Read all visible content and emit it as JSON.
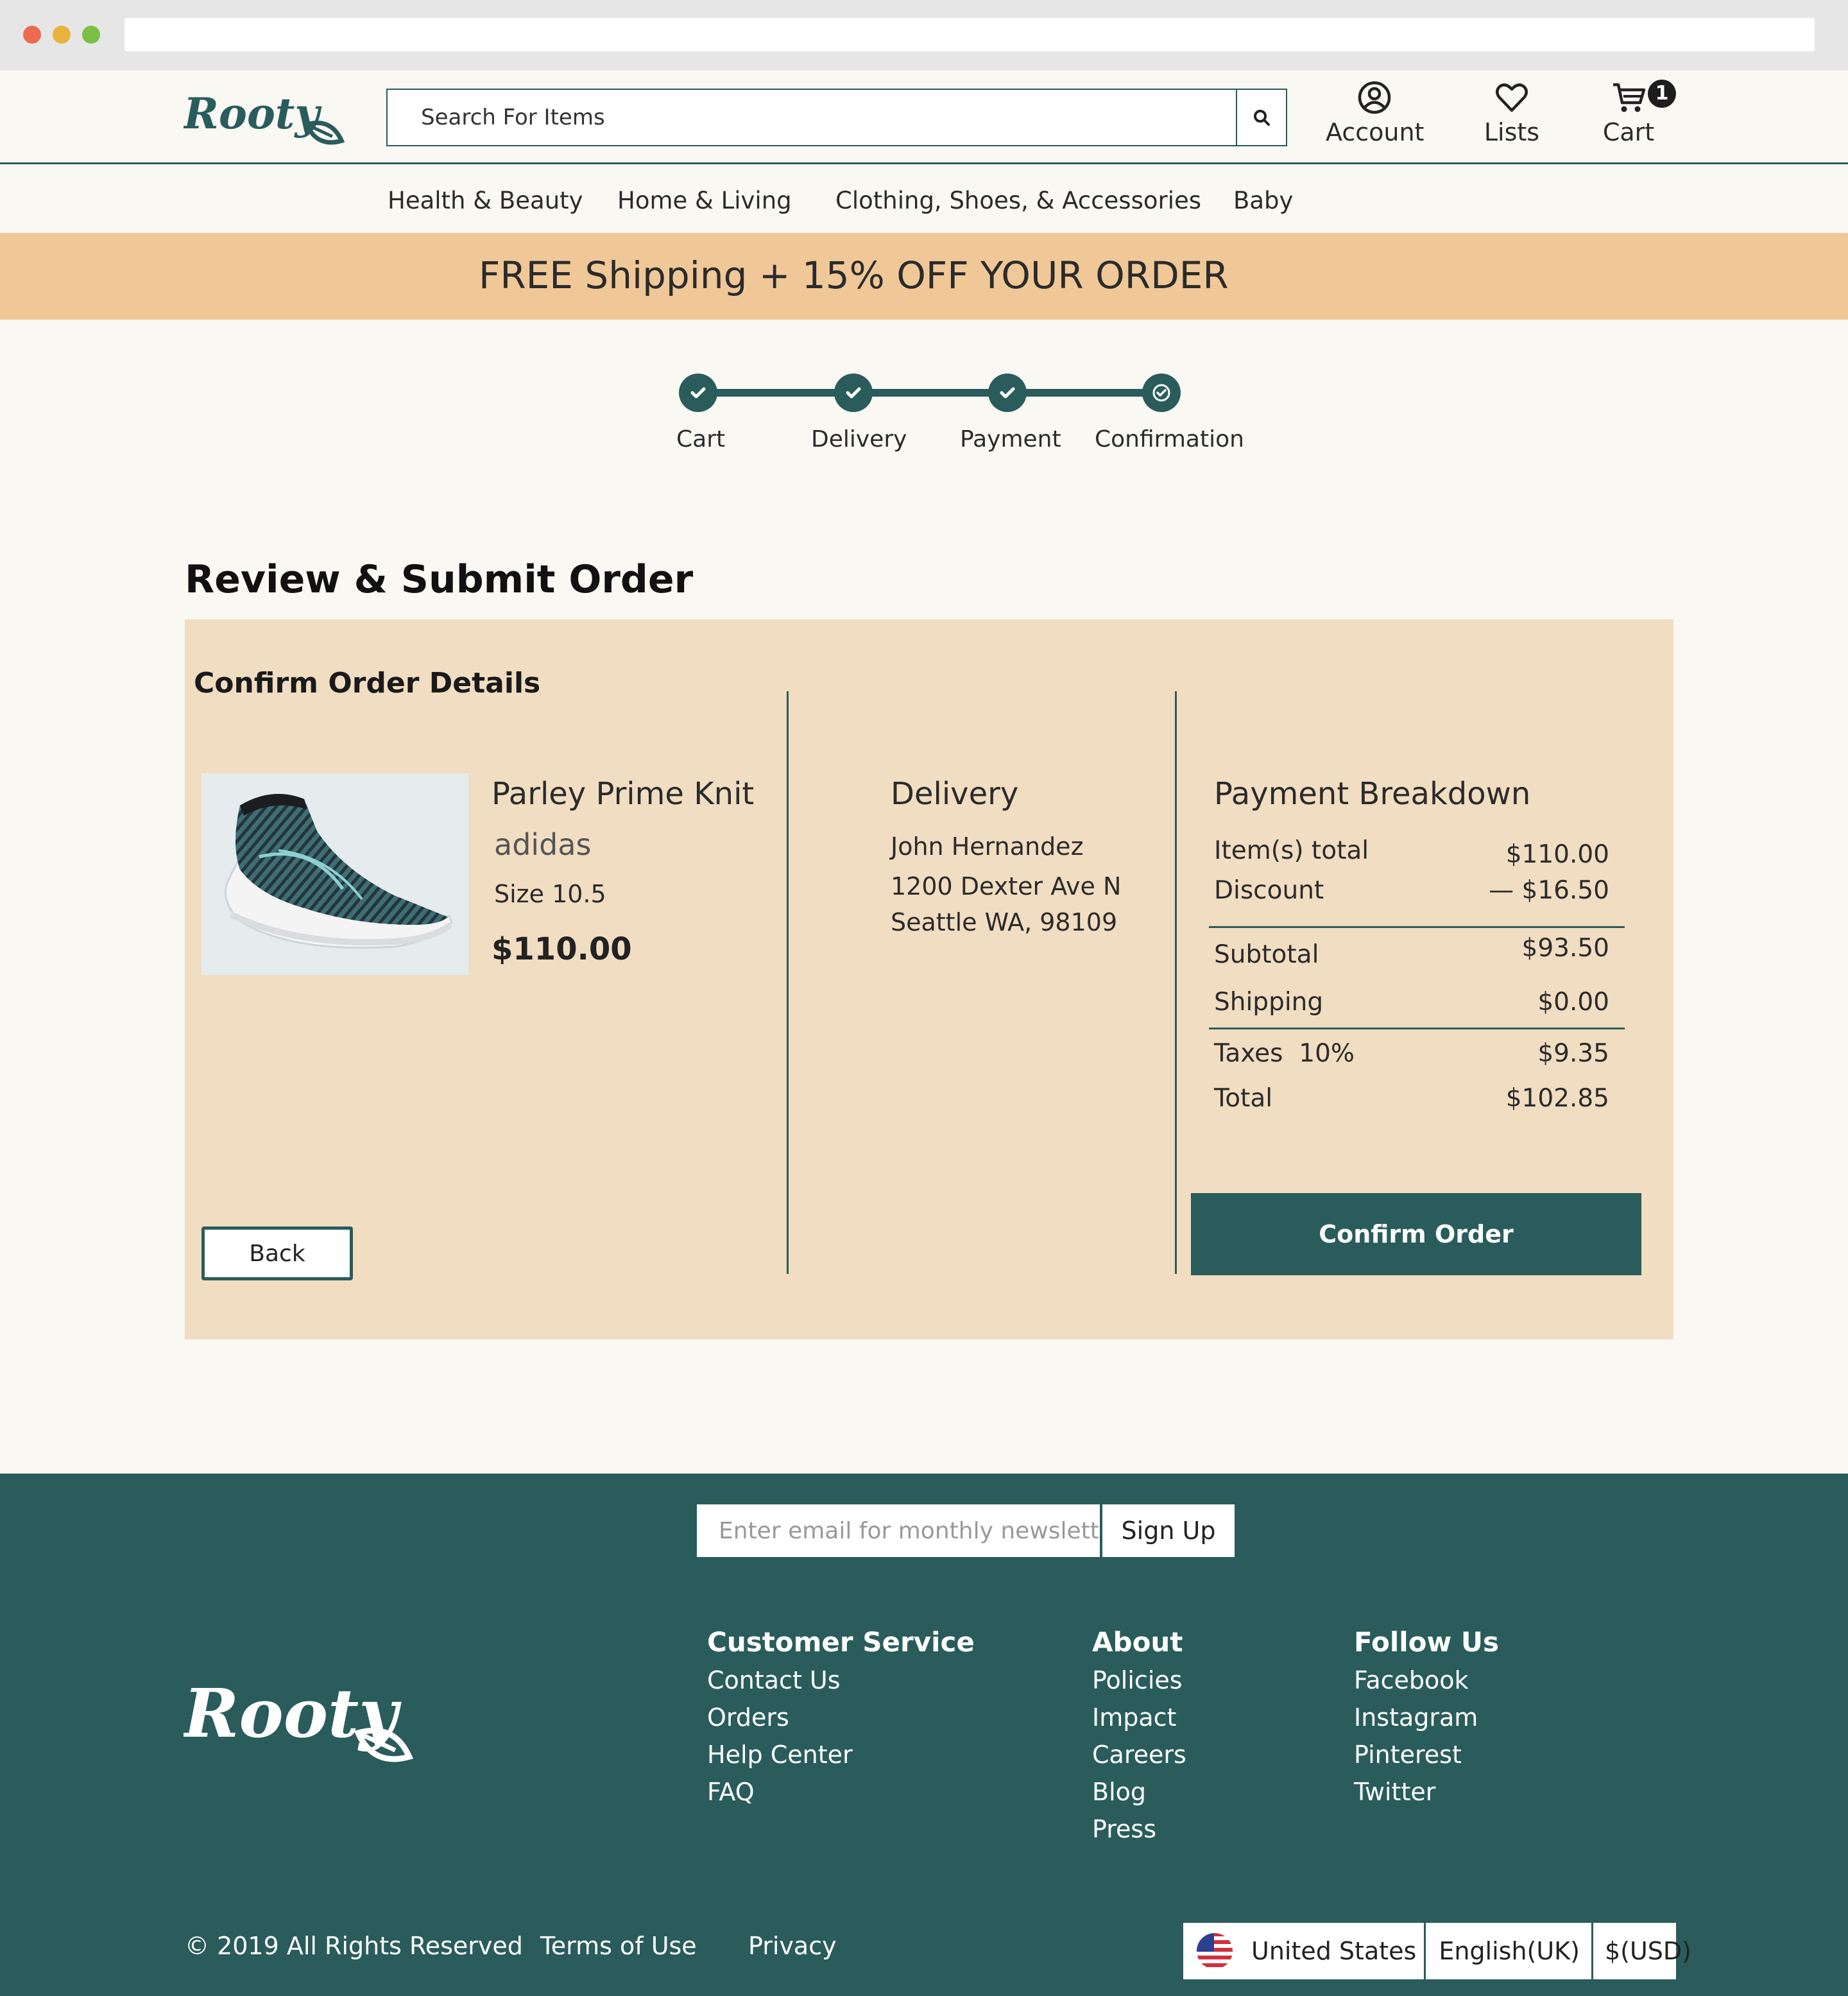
{
  "header": {
    "search_placeholder": "Search For Items",
    "account_label": "Account",
    "lists_label": "Lists",
    "cart_label": "Cart",
    "cart_count": "1"
  },
  "nav": {
    "categories": [
      "Health & Beauty",
      "Home & Living",
      "Clothing, Shoes, & Accessories",
      "Baby"
    ]
  },
  "promo": {
    "text": "FREE Shipping + 15% OFF  YOUR ORDER"
  },
  "progress": {
    "steps": [
      {
        "label": "Cart",
        "status": "complete"
      },
      {
        "label": "Delivery",
        "status": "complete"
      },
      {
        "label": "Payment",
        "status": "complete"
      },
      {
        "label": "Confirmation",
        "status": "current"
      }
    ]
  },
  "page": {
    "title": "Review & Submit Order"
  },
  "order": {
    "section_title": "Confirm Order Details",
    "product": {
      "name": "Parley Prime Knit",
      "brand": "adidas",
      "size": "Size 10.5",
      "price": "$110.00"
    },
    "back_label": "Back",
    "delivery": {
      "heading": "Delivery",
      "name": "John Hernandez",
      "address1": "1200 Dexter Ave N",
      "address2": "Seattle WA, 98109"
    },
    "payment": {
      "heading": "Payment Breakdown",
      "items_total_label": "Item(s) total",
      "items_total": "$110.00",
      "discount_label": "Discount",
      "discount": "— $16.50",
      "subtotal_label": "Subtotal",
      "subtotal": "$93.50",
      "shipping_label": "Shipping",
      "shipping": "$0.00",
      "taxes_label": "Taxes  10%",
      "taxes": "$9.35",
      "total_label": "Total",
      "total": "$102.85"
    },
    "confirm_label": "Confirm Order"
  },
  "footer": {
    "newsletter_placeholder": "Enter email for monthly newsletter",
    "signup_label": "Sign Up",
    "customer_service": {
      "heading": "Customer Service",
      "links": [
        "Contact Us",
        "Orders",
        "Help Center",
        "FAQ"
      ]
    },
    "about": {
      "heading": "About",
      "links": [
        "Policies",
        "Impact",
        "Careers",
        "Blog",
        "Press"
      ]
    },
    "follow": {
      "heading": "Follow Us",
      "links": [
        "Facebook",
        "Instagram",
        "Pinterest",
        "Twitter"
      ]
    },
    "copyright": "© 2019 All Rights Reserved",
    "terms": "Terms of Use",
    "privacy": "Privacy",
    "locale": {
      "country": "United States",
      "language": "English(UK)",
      "currency": "$(USD)"
    }
  },
  "colors": {
    "brand": "#2a5c5c",
    "promo": "#f0c898",
    "panel": "#f1ddc1",
    "background": "#faf8f3"
  },
  "icons": [
    "search-icon",
    "account-icon",
    "heart-icon",
    "cart-icon",
    "check-icon",
    "leaf-icon",
    "us-flag-icon"
  ]
}
